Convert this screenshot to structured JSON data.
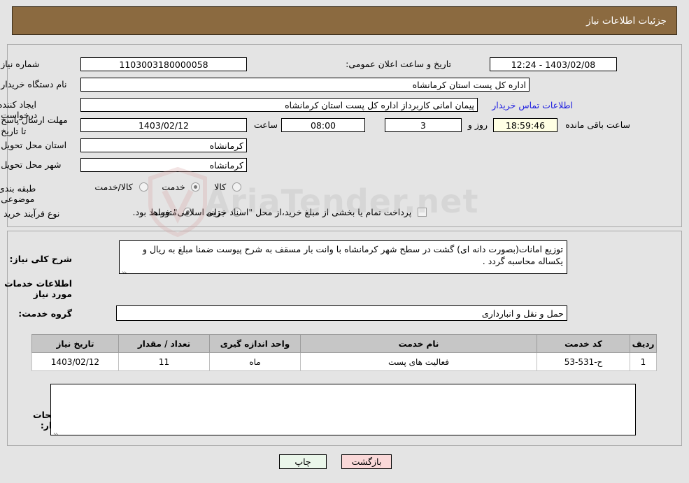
{
  "header": {
    "title": "جزئیات اطلاعات نیاز"
  },
  "watermark": {
    "text": "AriaTender.net"
  },
  "form": {
    "need_number": {
      "label": "شماره نیاز:",
      "value": "1103003180000058"
    },
    "announce_datetime": {
      "label": "تاریخ و ساعت اعلان عمومی:",
      "value": "12:24 - 1403/02/08"
    },
    "buyer_org": {
      "label": "نام دستگاه خریدار:",
      "value": "اداره کل پست استان کرمانشاه"
    },
    "request_creator": {
      "label": "ایجاد کننده درخواست:",
      "value": "پیمان امانی کاربرداز اداره کل پست استان کرمانشاه"
    },
    "contact_link": {
      "label": "اطلاعات تماس خریدار"
    },
    "deadline": {
      "label": "مهلت ارسال پاسخ: تا تاریخ:",
      "date": "1403/02/12",
      "hour_label": "ساعت",
      "hour": "08:00",
      "days": "3",
      "days_label": "روز و",
      "countdown": "18:59:46",
      "remaining_label": "ساعت باقی مانده"
    },
    "delivery_province": {
      "label": "استان محل تحویل:",
      "value": "کرمانشاه"
    },
    "delivery_city": {
      "label": "شهر محل تحویل:",
      "value": "کرمانشاه"
    },
    "subject_class": {
      "label": "طبقه بندی موضوعی:",
      "options": [
        "کالا",
        "خدمت",
        "کالا/خدمت"
      ],
      "selected": "خدمت"
    },
    "purchase_type": {
      "label": "نوع فرآیند خرید :",
      "options": [
        "جزیی",
        "متوسط"
      ],
      "selected": "متوسط",
      "checkbox_label": "پرداخت تمام یا بخشی از مبلغ خرید،از محل \"اسناد خزانه اسلامی\" خواهد بود.",
      "checkbox_checked": false
    }
  },
  "description": {
    "label": "شرح کلی نیاز:",
    "value": "توزیع امانات(بصورت دانه ای) گشت در سطح شهر کرمانشاه با وانت بار مسقف به شرح پیوست ضمنا مبلغ به ریال و یکساله محاسبه گردد ."
  },
  "services_section": {
    "title": "اطلاعات خدمات مورد نیاز",
    "group_label": "گروه خدمت:",
    "group_value": "حمل و نقل و انبارداری"
  },
  "table": {
    "columns": [
      "ردیف",
      "کد خدمت",
      "نام خدمت",
      "واحد اندازه گیری",
      "تعداد / مقدار",
      "تاریخ نیاز"
    ],
    "rows": [
      {
        "row": "1",
        "code": "ح-531-53",
        "name": "فعالیت های پست",
        "unit": "ماه",
        "quantity": "11",
        "date": "1403/02/12"
      }
    ]
  },
  "buyer_notes": {
    "label": "توضیحات خریدار:",
    "value": ""
  },
  "footer": {
    "print_label": "چاپ",
    "back_label": "بازگشت"
  }
}
